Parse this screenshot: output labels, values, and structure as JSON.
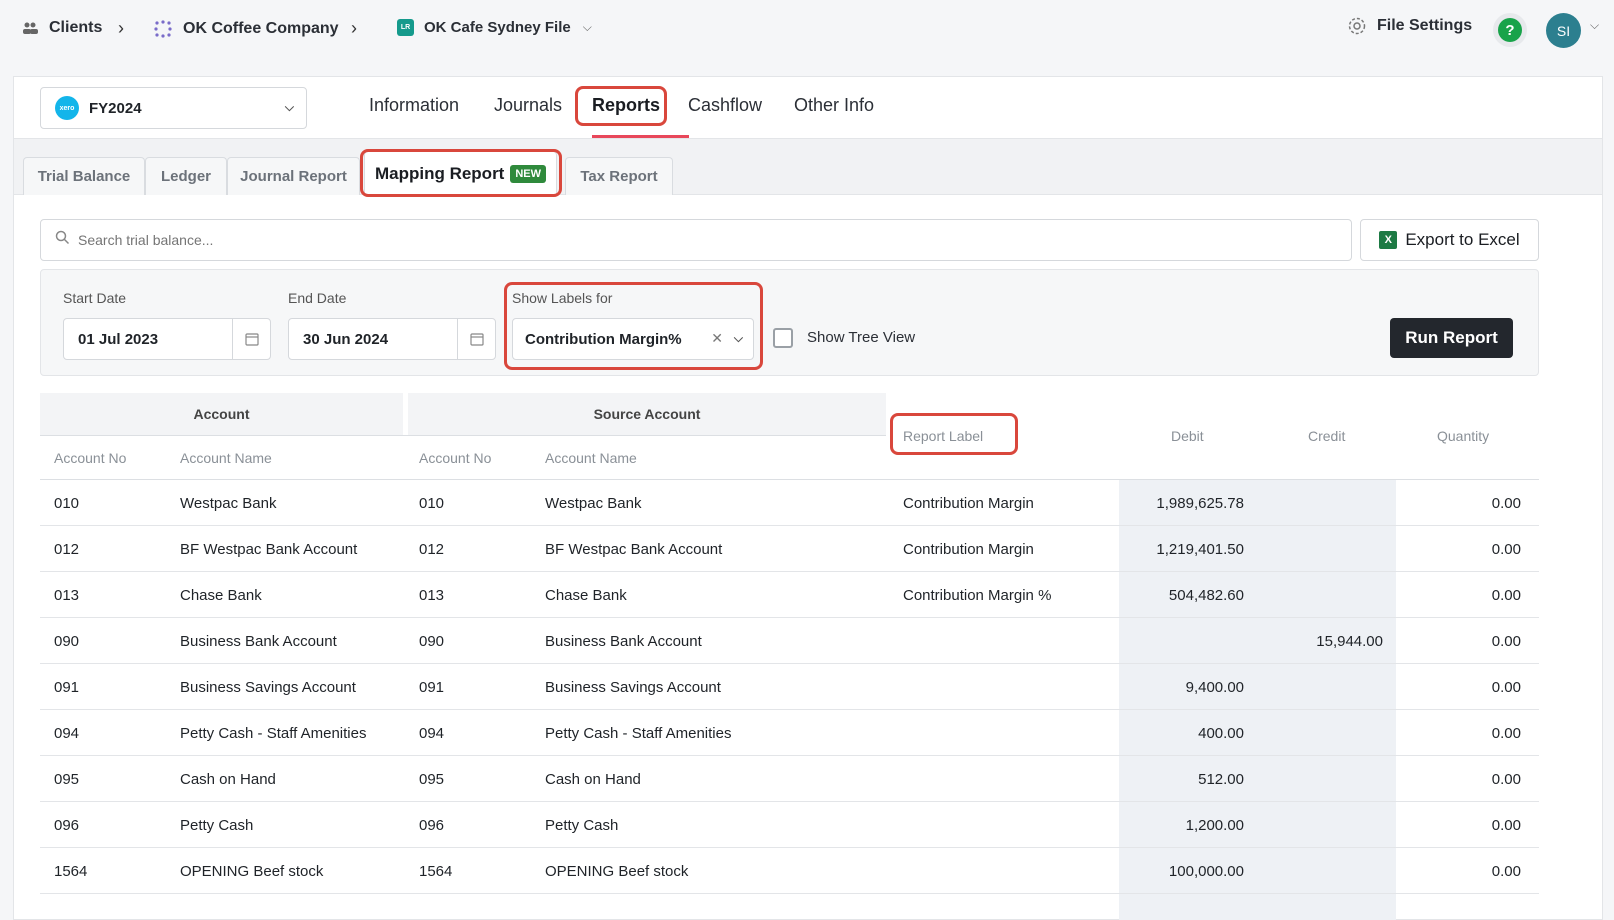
{
  "breadcrumb": {
    "clients": "Clients",
    "company": "OK Coffee Company",
    "file": "OK Cafe Sydney File",
    "file_chip": "LR"
  },
  "header": {
    "file_settings": "File Settings",
    "help": "?",
    "avatar": "SI"
  },
  "fy": {
    "logo": "xero",
    "label": "FY2024"
  },
  "nav_tabs": [
    "Information",
    "Journals",
    "Reports",
    "Cashflow",
    "Other Info"
  ],
  "sub_tabs": {
    "trial_balance": "Trial Balance",
    "ledger": "Ledger",
    "journal_report": "Journal Report",
    "mapping_report": "Mapping Report",
    "new_badge": "NEW",
    "tax_report": "Tax Report"
  },
  "search": {
    "placeholder": "Search trial balance..."
  },
  "export": {
    "label": "Export to Excel"
  },
  "filters": {
    "start_label": "Start Date",
    "start_value": "01 Jul 2023",
    "end_label": "End Date",
    "end_value": "30 Jun 2024",
    "labels_for": "Show Labels for",
    "labels_value": "Contribution Margin%",
    "tree_view": "Show Tree View",
    "run": "Run Report"
  },
  "table": {
    "group_account": "Account",
    "group_source": "Source Account",
    "col_account_no": "Account No",
    "col_account_name": "Account Name",
    "col_src_no": "Account No",
    "col_src_name": "Account Name",
    "col_report_label": "Report Label",
    "col_debit": "Debit",
    "col_credit": "Credit",
    "col_quantity": "Quantity",
    "rows": [
      [
        "010",
        "Westpac Bank",
        "010",
        "Westpac Bank",
        "Contribution Margin",
        "1,989,625.78",
        "",
        "0.00"
      ],
      [
        "012",
        "BF Westpac Bank Account",
        "012",
        "BF Westpac Bank Account",
        "Contribution Margin",
        "1,219,401.50",
        "",
        "0.00"
      ],
      [
        "013",
        "Chase Bank",
        "013",
        "Chase Bank",
        "Contribution Margin %",
        "504,482.60",
        "",
        "0.00"
      ],
      [
        "090",
        "Business Bank Account",
        "090",
        "Business Bank Account",
        "",
        "",
        "15,944.00",
        "0.00"
      ],
      [
        "091",
        "Business Savings Account",
        "091",
        "Business Savings Account",
        "",
        "9,400.00",
        "",
        "0.00"
      ],
      [
        "094",
        "Petty Cash - Staff Amenities",
        "094",
        "Petty Cash - Staff Amenities",
        "",
        "400.00",
        "",
        "0.00"
      ],
      [
        "095",
        "Cash on Hand",
        "095",
        "Cash on Hand",
        "",
        "512.00",
        "",
        "0.00"
      ],
      [
        "096",
        "Petty Cash",
        "096",
        "Petty Cash",
        "",
        "1,200.00",
        "",
        "0.00"
      ],
      [
        "1564",
        "OPENING Beef stock",
        "1564",
        "OPENING Beef stock",
        "",
        "100,000.00",
        "",
        "0.00"
      ]
    ]
  },
  "colors": {
    "highlight": "#d9473c",
    "run_button": "#23272d",
    "new_badge": "#2f8a3c",
    "help": "#19a34a",
    "avatar": "#2c7f8f"
  }
}
